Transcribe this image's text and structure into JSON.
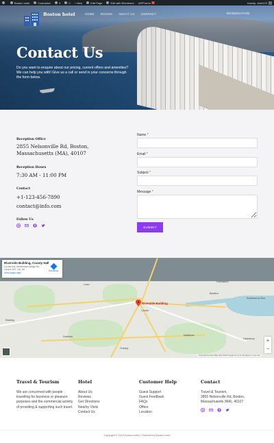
{
  "admin_bar": {
    "site_name": "Boston hotel",
    "customize": "Customize",
    "updates": "3",
    "comments": "0",
    "new": "New",
    "edit_page": "Edit Page",
    "elementor": "Edit with Elementor",
    "wpforms": "WPForms",
    "wpforms_badge": "1",
    "greeting": "Howdy, Josh123"
  },
  "header": {
    "site_title": "Boston hotel",
    "nav": [
      "HOME",
      "ROOMS",
      "ABOUT US",
      "CONTACT"
    ],
    "active_nav": "CONTACT",
    "reserve_label": "RESERVATION"
  },
  "hero": {
    "title": "Contact Us",
    "subtitle": "Do you want to enquire about our pricing, current offers and amenities? We can help you with! Give us a call or send in your concerns through the form below."
  },
  "contact_info": {
    "office_label": "Reception Office",
    "office_value": "2855 Nelsonville Rd, Boston, Massachusetts (MA), 40107",
    "hours_label": "Reception Hours",
    "hours_value": "7:30 AM - 11:00 PM",
    "contact_label": "Contact",
    "phone": "+1-123-456-7890",
    "email": "contact@info.com",
    "follow_label": "Follow Us",
    "social_icons": [
      "instagram-icon",
      "email-icon",
      "facebook-icon",
      "twitter-icon"
    ]
  },
  "form": {
    "fields": [
      {
        "label": "Name",
        "required": "*",
        "value": ""
      },
      {
        "label": "Email",
        "required": "*",
        "value": ""
      },
      {
        "label": "Subject",
        "required": "*",
        "value": ""
      },
      {
        "label": "Message",
        "required": "*",
        "value": ""
      }
    ],
    "submit_label": "SUBMIT",
    "accent": "#8d3bf0"
  },
  "map": {
    "place_title": "Riverside Building, County Hall",
    "place_address": "County Hall, Westminster Bridge Rd, London SE1 7JA, UK",
    "view_larger": "View larger map",
    "directions": "Directions",
    "pin_label": "Riverside Building",
    "cities": [
      "Reading",
      "London",
      "Southend-on-Sea",
      "Maidstone",
      "Guildford",
      "Crawley",
      "Chelmsford",
      "Canterbury",
      "Basildon",
      "Luton"
    ],
    "footer_text": "Keyboard shortcuts   Map data ©2023 Google   Terms of Use   Report a map error"
  },
  "footer": {
    "col1_title": "Travel & Tourism",
    "col1_text": "We are concerned with people travelling for business or pleasure purposes and the commercial activity of providing & supporting such travel.",
    "col2_title": "Hotel",
    "col2_links": [
      "About Us",
      "Reviews",
      "Get Directions",
      "Nearby Visits",
      "Contact Us"
    ],
    "col3_title": "Customer Help",
    "col3_links": [
      "Guest Support",
      "Guest Feedback",
      "FAQs",
      "Offers",
      "Location"
    ],
    "col4_title": "Contact",
    "col4_lines": [
      "Travel & Tourism,",
      "2855 Nelsonville Rd, Boston,",
      "Massachusetts (MA), 40107"
    ],
    "copyright": "Copyright © 2023 Boston hotel | Powered by Boston hotel"
  }
}
